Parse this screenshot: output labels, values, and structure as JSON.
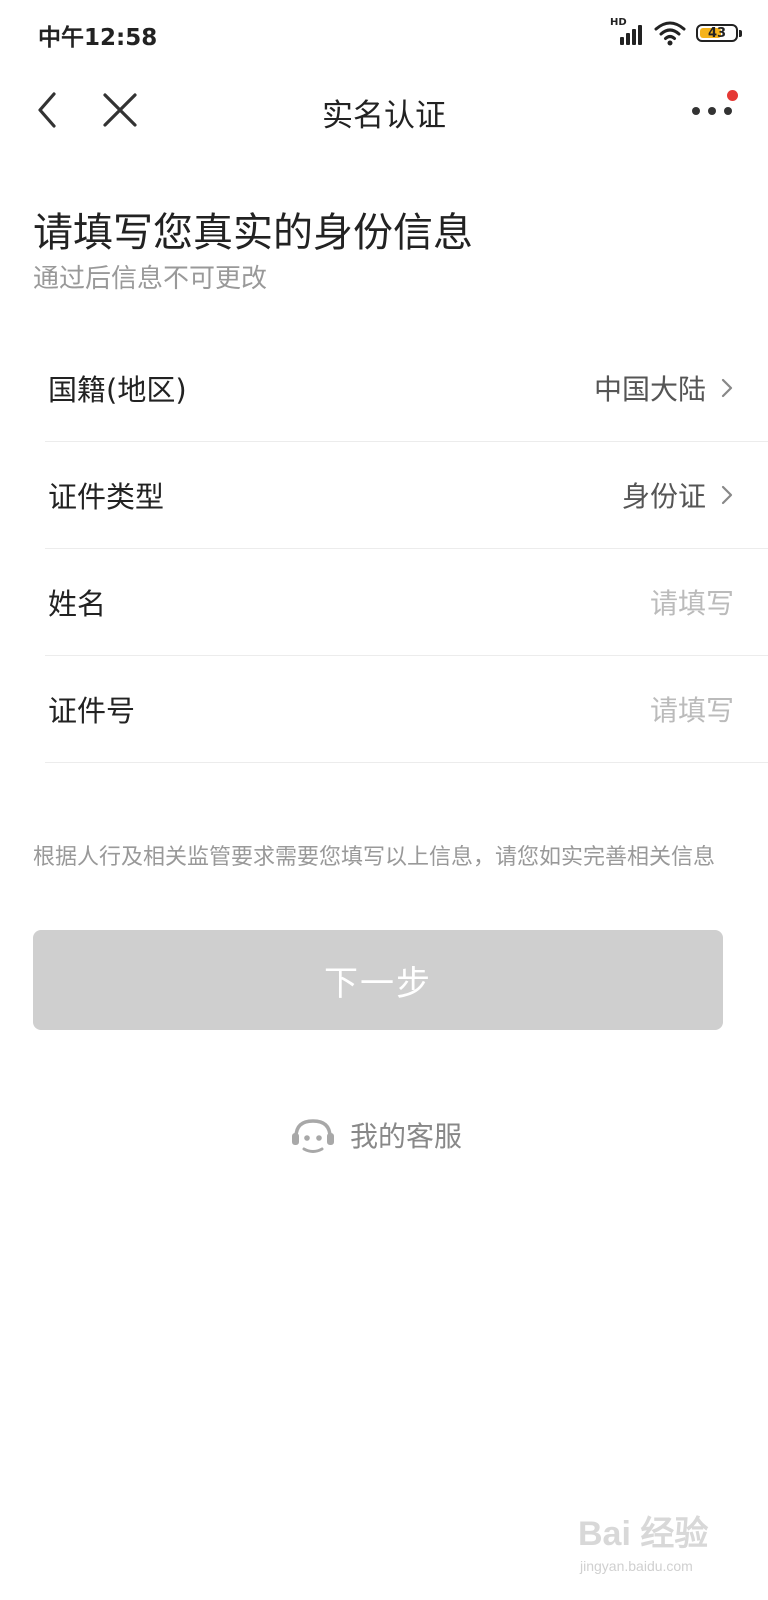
{
  "status_bar": {
    "time": "中午12:58",
    "network_label": "HD",
    "battery_level": "43",
    "battery_fill_color": "#f5b31a",
    "icons": [
      "signal-icon",
      "wifi-icon",
      "battery-icon"
    ]
  },
  "nav": {
    "title": "实名认证",
    "back_icon": "chevron-left-icon",
    "close_icon": "close-icon",
    "more_icon": "more-dots-icon",
    "badge_color": "#e53935"
  },
  "header": {
    "title": "请填写您真实的身份信息",
    "subtitle": "通过后信息不可更改"
  },
  "form": {
    "rows": [
      {
        "label": "国籍(地区)",
        "value": "中国大陆",
        "has_chevron": true
      },
      {
        "label": "证件类型",
        "value": "身份证",
        "has_chevron": true
      },
      {
        "label": "姓名",
        "placeholder": "请填写"
      },
      {
        "label": "证件号",
        "placeholder": "请填写"
      }
    ]
  },
  "notice": "根据人行及相关监管要求需要您填写以上信息，请您如实完善相关信息",
  "next_button": {
    "label": "下一步",
    "state": "disabled",
    "color": "#cfcfcf"
  },
  "customer_service": {
    "label": "我的客服",
    "icon": "customer-service-icon"
  },
  "watermark": {
    "brand": "Bai 经验",
    "domain": "jingyan.baidu.com"
  }
}
